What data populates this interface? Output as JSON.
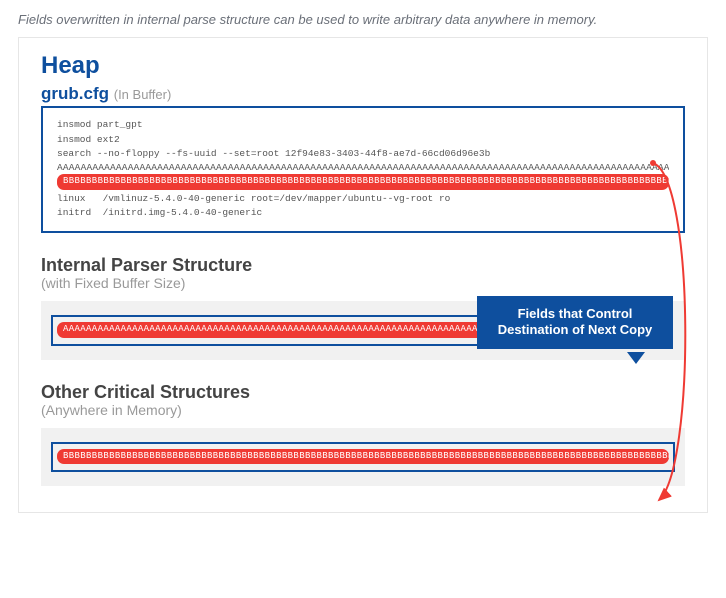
{
  "caption": "Fields overwritten in internal parse structure can be used to write arbitrary data anywhere in memory.",
  "heap_title": "Heap",
  "grubcfg": {
    "name": "grub.cfg",
    "sub": "(In Buffer)"
  },
  "code_lines": {
    "l1": "insmod part_gpt",
    "l2": "insmod ext2",
    "l3": "search --no-floppy --fs-uuid --set=root 12f94e83-3403-44f8-ae7d-66cd06d96e3b",
    "overflowA": "AAAAAAAAAAAAAAAAAAAAAAAAAAAAAAAAAAAAAAAAAAAAAAAAAAAAAAAAAAAAAAAAAAAAAAAAAAAAAAAAAAAAAAAAAAAAAAAAAAAAAAAAAAAAA",
    "overflowB": "BBBBBBBBBBBBBBBBBBBBBBBBBBBBBBBBBBBBBBBBBBBBBBBBBBBBBBBBBBBBBBBBBBBBBBBBBBBBBBBBBBBBBBBBBBBBBBBBBBBBBBBBBBBBBBBBBBBBBBBBBBBBBBBBBBBBBBBBBBBBBBBBBBBBBBBBBBBBBBBB",
    "l4": "linux   /vmlinuz-5.4.0-40-generic root=/dev/mapper/ubuntu--vg-root ro",
    "l5": "initrd  /initrd.img-5.4.0-40-generic"
  },
  "parser": {
    "title": "Internal Parser Structure",
    "sub": "(with Fixed Buffer Size)",
    "leftA": "AAAAAAAAAAAAAAAAAAAAAAAAAAAAAAAAAAAAAAAAAAAAAAAAAAAAAAAAAAAAAAAAAAAAAAAAAAAAAAAAAAAAAAAAAAAAAAAAAAAAAAAAAAAAAAAAAAAAAAAAAAAAAAAAAAAAAAAAAAAAAAA",
    "rightA": "AAAAAAAAAAAAAAAAAAAAAAAAAAAAAAAAAAAA"
  },
  "other": {
    "title": "Other Critical Structures",
    "sub": "(Anywhere in Memory)",
    "pillB": "BBBBBBBBBBBBBBBBBBBBBBBBBBBBBBBBBBBBBBBBBBBBBBBBBBBBBBBBBBBBBBBBBBBBBBBBBBBBBBBBBBBBBBBBBBBBBBBBBBBBBBBBBBBBBBBBBBBBBBBBBBBBBBBBBBBBBBBBBBBBBBBBBBBBBBBBBBBBBBBBBBBBBBBBBBBBBBBBBBBBBBBBBBBBBBBBBBBBBBBBBBBB"
  },
  "callout": "Fields that Control Destination of Next Copy"
}
